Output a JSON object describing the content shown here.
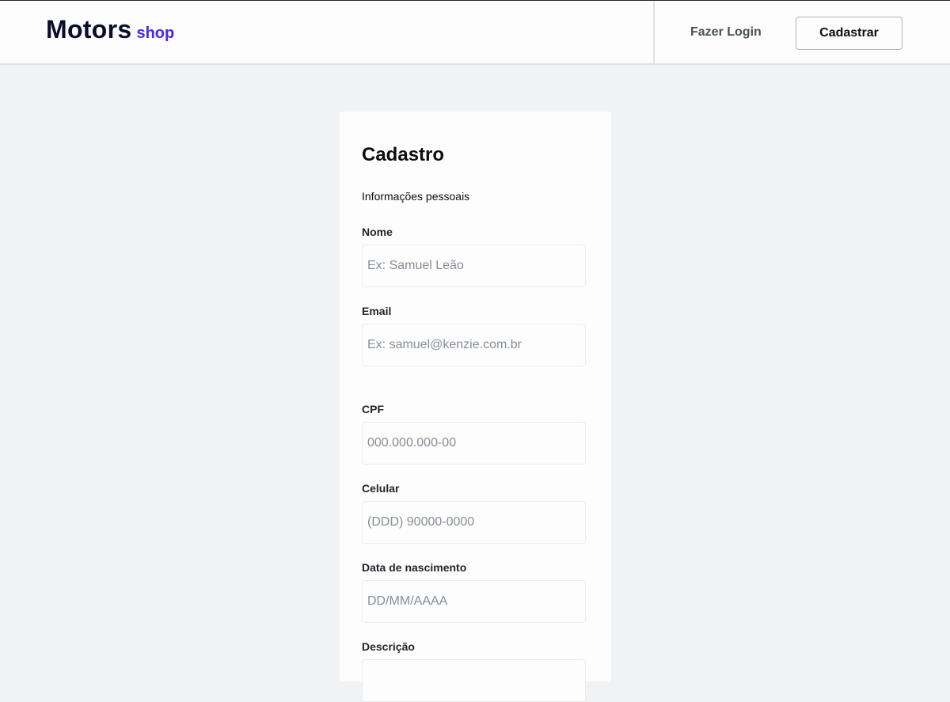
{
  "header": {
    "brand_main": "Motors",
    "brand_sub": "shop",
    "login_label": "Fazer Login",
    "register_label": "Cadastrar"
  },
  "form": {
    "title": "Cadastro",
    "section_title": "Informações pessoais",
    "fields": [
      {
        "label": "Nome",
        "value": "",
        "placeholder": "Ex: Samuel Leão"
      },
      {
        "label": "Email",
        "value": "",
        "placeholder": "Ex: samuel@kenzie.com.br"
      },
      {
        "label": "CPF",
        "value": "",
        "placeholder": "000.000.000-00"
      },
      {
        "label": "Celular",
        "value": "",
        "placeholder": "(DDD) 90000-0000"
      },
      {
        "label": "Data de nascimento",
        "value": "",
        "placeholder": "DD/MM/AAAA"
      },
      {
        "label": "Descrição",
        "value": "",
        "placeholder": ""
      }
    ]
  },
  "colors": {
    "brand_dark": "#0b0d2e",
    "brand_accent": "#4529e6",
    "page_background": "#f1f2f4",
    "card_background": "#fdfdfd"
  }
}
